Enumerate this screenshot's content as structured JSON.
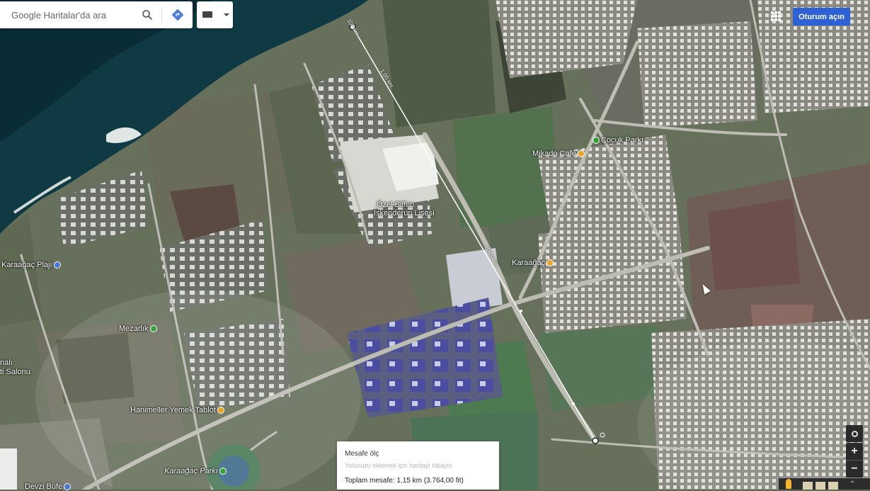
{
  "search": {
    "placeholder": "Google Haritalar'da ara"
  },
  "header": {
    "signin_label": "Oturum açın"
  },
  "places": {
    "cocuk_parki": "Çocuk Parkı",
    "mikado_cafe": "Mikado Cafe",
    "ozel_bilfen_1": "Özel Bilfen",
    "ozel_bilfen_2": "İskenderun Lisesi",
    "karaagac": "Karaağaç",
    "karaagac_plaji": "Karaağaç Plajı",
    "mezarlik": "Mezarlık",
    "salonu_1": "nalı",
    "salonu_2": "ti Salonu",
    "hanimeller": "Hanimeller Yemek Tablot",
    "karaagac_parki": "Karaağaç Parkı",
    "devzi_bufe": "Devzi Büfe"
  },
  "measure": {
    "title": "Mesafe ölç",
    "hint": "Yolunuzu eklemek için haritayı tıklayın",
    "total": "Toplam mesafe: 1,15 km (3.764,00 fit)"
  },
  "measure_line": {
    "tick_labels": [
      "100 km",
      "1,00 km",
      "100,00 m"
    ]
  },
  "controls": {
    "zoom_in": "+",
    "zoom_out": "−",
    "expand": "⌃"
  },
  "colors": {
    "signin_button": "#2d62d6",
    "measure_line": "#ffffff",
    "sea": "#0f3a44"
  }
}
